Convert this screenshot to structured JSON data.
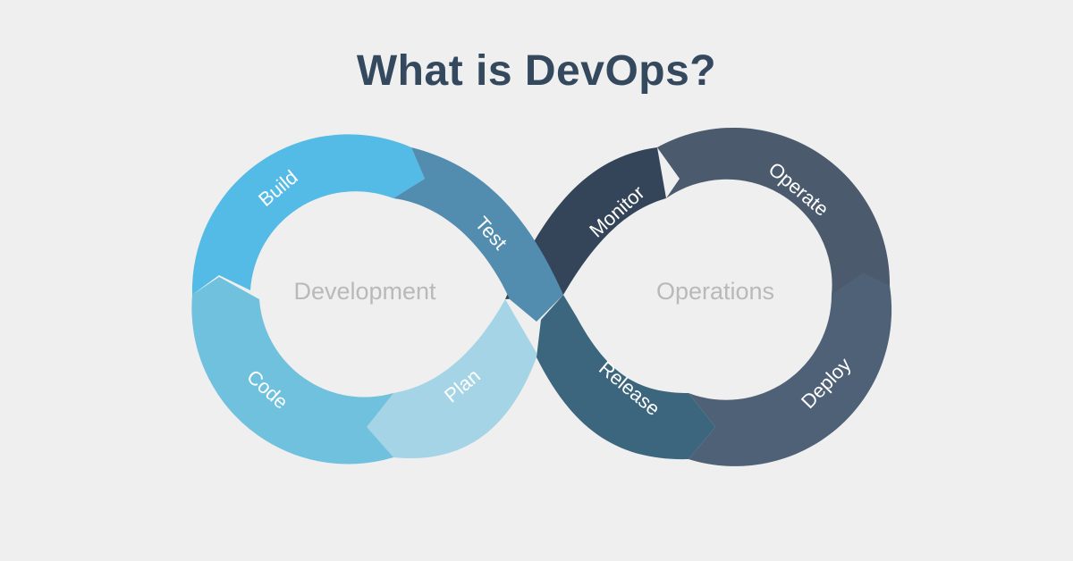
{
  "title": "What is DevOps?",
  "loops": {
    "left": "Development",
    "right": "Operations"
  },
  "stages": {
    "build": "Build",
    "test": "Test",
    "code": "Code",
    "plan": "Plan",
    "monitor": "Monitor",
    "operate": "Operate",
    "release": "Release",
    "deploy": "Deploy"
  },
  "colors": {
    "background": "#efefef",
    "title": "#34495e",
    "build": "#53bbe6",
    "code": "#6fc1de",
    "plan": "#a4d4e5",
    "test": "#528cae",
    "release": "#3b667d",
    "monitor": "#344559",
    "operate": "#4b5b6d",
    "deploy": "#4f6177",
    "loop_label": "#b9b9b9"
  }
}
